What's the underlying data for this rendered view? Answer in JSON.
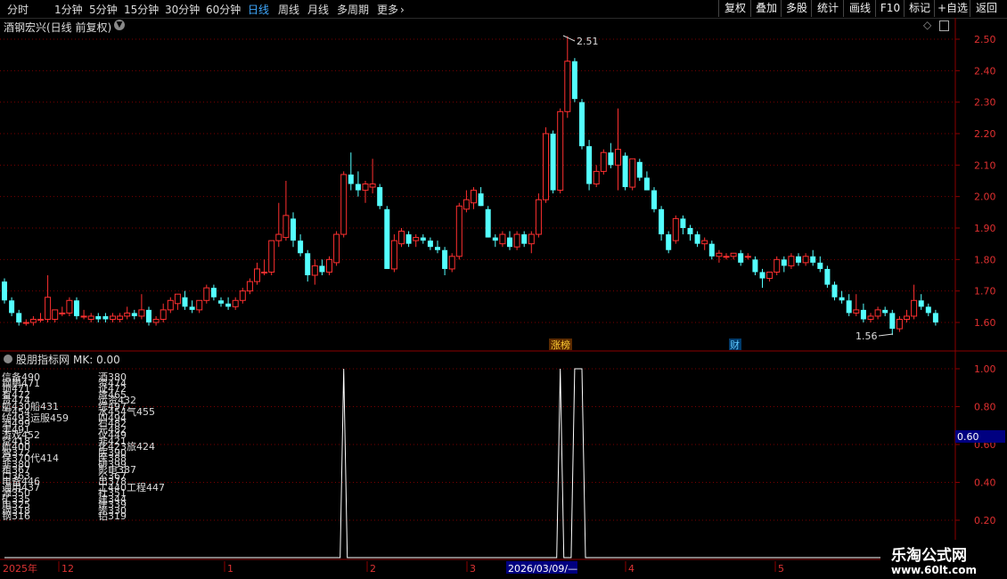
{
  "toolbar": {
    "periods": [
      "分时",
      "1分钟",
      "5分钟",
      "15分钟",
      "30分钟",
      "60分钟",
      "日线",
      "周线",
      "月线",
      "多周期",
      "更多"
    ],
    "active_period": "日线",
    "more_arrow": "›",
    "right_buttons": [
      "复权",
      "叠加",
      "多股",
      "统计",
      "画线",
      "F10",
      "标记",
      "+自选",
      "返回"
    ]
  },
  "header": {
    "stock_title": "酒钢宏兴(日线 前复权)",
    "chevron_icon": "chevron-down-icon",
    "diamond_icon": "diamond-icon",
    "panel_icon": "panel-toggle-icon"
  },
  "price_axis": {
    "labels": [
      "2.50",
      "2.40",
      "2.30",
      "2.20",
      "2.10",
      "2.00",
      "1.90",
      "1.80",
      "1.70",
      "1.60"
    ]
  },
  "annotations": {
    "high_label": "2.51",
    "low_label": "1.56",
    "event_zhangbang": "涨榜",
    "event_cai": "财"
  },
  "indicator": {
    "title": "股朋指标网",
    "mk_label": "MK: 0.00",
    "axis_labels": [
      "1.00",
      "0.80",
      "0.60",
      "0.40",
      "0.20"
    ],
    "highlight_value": "0.60",
    "col1": [
      "信备490",
      "钢鹏471",
      "锁471",
      "有472",
      "贵474",
      "航430船431",
      "汽454",
      "纺493运服459",
      "酒499",
      "丰491",
      "游戏452",
      "空418",
      "航400",
      "智372",
      "保370代414",
      "非380",
      "租367",
      "口363",
      "电备446",
      "通用437",
      "源350",
      "矿335",
      "电325",
      "钢318",
      "钢316"
    ],
    "col2": [
      "酒380",
      "资474",
      "证472",
      "旅465",
      "运资432",
      "综497",
      "水454气455",
      "四494",
      "石482",
      "元482",
      "仪449",
      "非421",
      "化423旅424",
      "医390",
      "医388",
      "研399",
      "影电387",
      "公367",
      "出378",
      "工440工程447",
      "社351",
      "建344",
      "建339",
      "光330",
      "铝319"
    ]
  },
  "date_axis": {
    "labels": [
      "2025年",
      "12",
      "1",
      "2",
      "3",
      "4",
      "5"
    ],
    "cursor_date": "2026/03/09/—"
  },
  "watermark": {
    "line1": "乐淘公式网",
    "line2": "www.60lt.com"
  },
  "chart_data": {
    "type": "candlestick",
    "ylim": [
      1.55,
      2.53
    ],
    "y_ticks": [
      1.6,
      1.7,
      1.8,
      1.9,
      2.0,
      2.1,
      2.2,
      2.3,
      2.4,
      2.5
    ],
    "max_price": 2.51,
    "min_price": 1.56,
    "candles": [
      {
        "o": 1.73,
        "h": 1.74,
        "l": 1.66,
        "c": 1.67
      },
      {
        "o": 1.67,
        "h": 1.68,
        "l": 1.62,
        "c": 1.63
      },
      {
        "o": 1.63,
        "h": 1.64,
        "l": 1.59,
        "c": 1.6
      },
      {
        "o": 1.6,
        "h": 1.61,
        "l": 1.59,
        "c": 1.6
      },
      {
        "o": 1.6,
        "h": 1.62,
        "l": 1.59,
        "c": 1.61
      },
      {
        "o": 1.61,
        "h": 1.63,
        "l": 1.6,
        "c": 1.61
      },
      {
        "o": 1.61,
        "h": 1.75,
        "l": 1.6,
        "c": 1.68
      },
      {
        "o": 1.61,
        "h": 1.64,
        "l": 1.6,
        "c": 1.64
      },
      {
        "o": 1.63,
        "h": 1.65,
        "l": 1.62,
        "c": 1.63
      },
      {
        "o": 1.63,
        "h": 1.68,
        "l": 1.62,
        "c": 1.67
      },
      {
        "o": 1.67,
        "h": 1.68,
        "l": 1.61,
        "c": 1.62
      },
      {
        "o": 1.62,
        "h": 1.64,
        "l": 1.61,
        "c": 1.62
      },
      {
        "o": 1.61,
        "h": 1.63,
        "l": 1.6,
        "c": 1.62
      },
      {
        "o": 1.62,
        "h": 1.63,
        "l": 1.6,
        "c": 1.61
      },
      {
        "o": 1.62,
        "h": 1.63,
        "l": 1.6,
        "c": 1.61
      },
      {
        "o": 1.61,
        "h": 1.63,
        "l": 1.6,
        "c": 1.62
      },
      {
        "o": 1.61,
        "h": 1.63,
        "l": 1.6,
        "c": 1.62
      },
      {
        "o": 1.62,
        "h": 1.65,
        "l": 1.61,
        "c": 1.63
      },
      {
        "o": 1.63,
        "h": 1.64,
        "l": 1.61,
        "c": 1.62
      },
      {
        "o": 1.62,
        "h": 1.69,
        "l": 1.61,
        "c": 1.64
      },
      {
        "o": 1.64,
        "h": 1.65,
        "l": 1.59,
        "c": 1.6
      },
      {
        "o": 1.6,
        "h": 1.62,
        "l": 1.59,
        "c": 1.61
      },
      {
        "o": 1.61,
        "h": 1.66,
        "l": 1.6,
        "c": 1.64
      },
      {
        "o": 1.64,
        "h": 1.68,
        "l": 1.63,
        "c": 1.67
      },
      {
        "o": 1.66,
        "h": 1.69,
        "l": 1.64,
        "c": 1.69
      },
      {
        "o": 1.68,
        "h": 1.7,
        "l": 1.64,
        "c": 1.65
      },
      {
        "o": 1.65,
        "h": 1.67,
        "l": 1.63,
        "c": 1.64
      },
      {
        "o": 1.64,
        "h": 1.67,
        "l": 1.63,
        "c": 1.67
      },
      {
        "o": 1.67,
        "h": 1.72,
        "l": 1.66,
        "c": 1.71
      },
      {
        "o": 1.71,
        "h": 1.72,
        "l": 1.67,
        "c": 1.68
      },
      {
        "o": 1.67,
        "h": 1.68,
        "l": 1.65,
        "c": 1.66
      },
      {
        "o": 1.66,
        "h": 1.68,
        "l": 1.64,
        "c": 1.65
      },
      {
        "o": 1.65,
        "h": 1.68,
        "l": 1.64,
        "c": 1.67
      },
      {
        "o": 1.67,
        "h": 1.71,
        "l": 1.66,
        "c": 1.7
      },
      {
        "o": 1.7,
        "h": 1.74,
        "l": 1.69,
        "c": 1.73
      },
      {
        "o": 1.73,
        "h": 1.79,
        "l": 1.72,
        "c": 1.77
      },
      {
        "o": 1.76,
        "h": 1.8,
        "l": 1.75,
        "c": 1.76
      },
      {
        "o": 1.76,
        "h": 1.86,
        "l": 1.75,
        "c": 1.86
      },
      {
        "o": 1.86,
        "h": 1.98,
        "l": 1.84,
        "c": 1.88
      },
      {
        "o": 1.87,
        "h": 2.05,
        "l": 1.86,
        "c": 1.94
      },
      {
        "o": 1.93,
        "h": 1.95,
        "l": 1.84,
        "c": 1.86
      },
      {
        "o": 1.86,
        "h": 1.88,
        "l": 1.81,
        "c": 1.82
      },
      {
        "o": 1.82,
        "h": 1.83,
        "l": 1.73,
        "c": 1.75
      },
      {
        "o": 1.75,
        "h": 1.8,
        "l": 1.72,
        "c": 1.78
      },
      {
        "o": 1.78,
        "h": 1.8,
        "l": 1.75,
        "c": 1.76
      },
      {
        "o": 1.76,
        "h": 1.81,
        "l": 1.75,
        "c": 1.8
      },
      {
        "o": 1.79,
        "h": 1.89,
        "l": 1.78,
        "c": 1.88
      },
      {
        "o": 1.88,
        "h": 2.08,
        "l": 1.87,
        "c": 2.07
      },
      {
        "o": 2.07,
        "h": 2.14,
        "l": 2.02,
        "c": 2.04
      },
      {
        "o": 2.04,
        "h": 2.08,
        "l": 2.0,
        "c": 2.02
      },
      {
        "o": 2.02,
        "h": 2.05,
        "l": 1.98,
        "c": 2.04
      },
      {
        "o": 2.03,
        "h": 2.12,
        "l": 2.01,
        "c": 2.04
      },
      {
        "o": 2.03,
        "h": 2.04,
        "l": 1.96,
        "c": 1.97
      },
      {
        "o": 1.96,
        "h": 1.97,
        "l": 1.77,
        "c": 1.77
      },
      {
        "o": 1.77,
        "h": 1.88,
        "l": 1.76,
        "c": 1.86
      },
      {
        "o": 1.85,
        "h": 1.9,
        "l": 1.84,
        "c": 1.89
      },
      {
        "o": 1.88,
        "h": 1.89,
        "l": 1.84,
        "c": 1.85
      },
      {
        "o": 1.86,
        "h": 1.88,
        "l": 1.84,
        "c": 1.87
      },
      {
        "o": 1.87,
        "h": 1.88,
        "l": 1.85,
        "c": 1.86
      },
      {
        "o": 1.86,
        "h": 1.87,
        "l": 1.83,
        "c": 1.84
      },
      {
        "o": 1.84,
        "h": 1.86,
        "l": 1.82,
        "c": 1.83
      },
      {
        "o": 1.83,
        "h": 1.84,
        "l": 1.75,
        "c": 1.77
      },
      {
        "o": 1.77,
        "h": 1.82,
        "l": 1.76,
        "c": 1.81
      },
      {
        "o": 1.81,
        "h": 1.98,
        "l": 1.8,
        "c": 1.97
      },
      {
        "o": 1.96,
        "h": 2.02,
        "l": 1.95,
        "c": 1.99
      },
      {
        "o": 1.98,
        "h": 2.03,
        "l": 1.96,
        "c": 2.02
      },
      {
        "o": 2.01,
        "h": 2.03,
        "l": 1.97,
        "c": 1.97
      },
      {
        "o": 1.96,
        "h": 1.97,
        "l": 1.87,
        "c": 1.87
      },
      {
        "o": 1.87,
        "h": 1.88,
        "l": 1.84,
        "c": 1.86
      },
      {
        "o": 1.85,
        "h": 1.89,
        "l": 1.84,
        "c": 1.88
      },
      {
        "o": 1.87,
        "h": 1.89,
        "l": 1.83,
        "c": 1.84
      },
      {
        "o": 1.84,
        "h": 1.89,
        "l": 1.83,
        "c": 1.88
      },
      {
        "o": 1.88,
        "h": 1.89,
        "l": 1.84,
        "c": 1.85
      },
      {
        "o": 1.85,
        "h": 1.89,
        "l": 1.82,
        "c": 1.88
      },
      {
        "o": 1.88,
        "h": 2.01,
        "l": 1.87,
        "c": 1.99
      },
      {
        "o": 1.99,
        "h": 2.22,
        "l": 1.98,
        "c": 2.2
      },
      {
        "o": 2.2,
        "h": 2.21,
        "l": 2.01,
        "c": 2.02
      },
      {
        "o": 2.02,
        "h": 2.28,
        "l": 2.01,
        "c": 2.27
      },
      {
        "o": 2.27,
        "h": 2.51,
        "l": 2.25,
        "c": 2.43
      },
      {
        "o": 2.43,
        "h": 2.44,
        "l": 2.3,
        "c": 2.31
      },
      {
        "o": 2.3,
        "h": 2.31,
        "l": 2.15,
        "c": 2.16
      },
      {
        "o": 2.16,
        "h": 2.18,
        "l": 2.02,
        "c": 2.04
      },
      {
        "o": 2.04,
        "h": 2.1,
        "l": 2.03,
        "c": 2.08
      },
      {
        "o": 2.08,
        "h": 2.15,
        "l": 2.07,
        "c": 2.14
      },
      {
        "o": 2.14,
        "h": 2.17,
        "l": 2.09,
        "c": 2.1
      },
      {
        "o": 2.1,
        "h": 2.28,
        "l": 2.02,
        "c": 2.15
      },
      {
        "o": 2.13,
        "h": 2.14,
        "l": 2.02,
        "c": 2.03
      },
      {
        "o": 2.03,
        "h": 2.12,
        "l": 2.02,
        "c": 2.12
      },
      {
        "o": 2.11,
        "h": 2.12,
        "l": 2.05,
        "c": 2.06
      },
      {
        "o": 2.06,
        "h": 2.08,
        "l": 2.02,
        "c": 2.02
      },
      {
        "o": 2.02,
        "h": 2.03,
        "l": 1.95,
        "c": 1.96
      },
      {
        "o": 1.96,
        "h": 1.97,
        "l": 1.86,
        "c": 1.88
      },
      {
        "o": 1.88,
        "h": 1.89,
        "l": 1.82,
        "c": 1.83
      },
      {
        "o": 1.86,
        "h": 1.94,
        "l": 1.85,
        "c": 1.93
      },
      {
        "o": 1.93,
        "h": 1.94,
        "l": 1.88,
        "c": 1.9
      },
      {
        "o": 1.9,
        "h": 1.91,
        "l": 1.86,
        "c": 1.88
      },
      {
        "o": 1.88,
        "h": 1.89,
        "l": 1.84,
        "c": 1.85
      },
      {
        "o": 1.85,
        "h": 1.87,
        "l": 1.83,
        "c": 1.86
      },
      {
        "o": 1.85,
        "h": 1.86,
        "l": 1.8,
        "c": 1.81
      },
      {
        "o": 1.81,
        "h": 1.83,
        "l": 1.79,
        "c": 1.82
      },
      {
        "o": 1.81,
        "h": 1.82,
        "l": 1.8,
        "c": 1.81
      },
      {
        "o": 1.81,
        "h": 1.82,
        "l": 1.8,
        "c": 1.82
      },
      {
        "o": 1.82,
        "h": 1.83,
        "l": 1.78,
        "c": 1.79
      },
      {
        "o": 1.81,
        "h": 1.82,
        "l": 1.8,
        "c": 1.81
      },
      {
        "o": 1.8,
        "h": 1.81,
        "l": 1.75,
        "c": 1.76
      },
      {
        "o": 1.76,
        "h": 1.77,
        "l": 1.71,
        "c": 1.74
      },
      {
        "o": 1.74,
        "h": 1.76,
        "l": 1.73,
        "c": 1.76
      },
      {
        "o": 1.76,
        "h": 1.81,
        "l": 1.75,
        "c": 1.8
      },
      {
        "o": 1.8,
        "h": 1.81,
        "l": 1.76,
        "c": 1.78
      },
      {
        "o": 1.78,
        "h": 1.82,
        "l": 1.77,
        "c": 1.81
      },
      {
        "o": 1.81,
        "h": 1.82,
        "l": 1.78,
        "c": 1.79
      },
      {
        "o": 1.79,
        "h": 1.82,
        "l": 1.78,
        "c": 1.81
      },
      {
        "o": 1.81,
        "h": 1.83,
        "l": 1.78,
        "c": 1.79
      },
      {
        "o": 1.79,
        "h": 1.81,
        "l": 1.76,
        "c": 1.77
      },
      {
        "o": 1.77,
        "h": 1.78,
        "l": 1.71,
        "c": 1.72
      },
      {
        "o": 1.72,
        "h": 1.73,
        "l": 1.67,
        "c": 1.68
      },
      {
        "o": 1.68,
        "h": 1.7,
        "l": 1.66,
        "c": 1.67
      },
      {
        "o": 1.67,
        "h": 1.69,
        "l": 1.62,
        "c": 1.63
      },
      {
        "o": 1.63,
        "h": 1.69,
        "l": 1.62,
        "c": 1.64
      },
      {
        "o": 1.64,
        "h": 1.66,
        "l": 1.6,
        "c": 1.61
      },
      {
        "o": 1.61,
        "h": 1.63,
        "l": 1.6,
        "c": 1.62
      },
      {
        "o": 1.62,
        "h": 1.65,
        "l": 1.61,
        "c": 1.64
      },
      {
        "o": 1.64,
        "h": 1.65,
        "l": 1.62,
        "c": 1.63
      },
      {
        "o": 1.63,
        "h": 1.64,
        "l": 1.56,
        "c": 1.58
      },
      {
        "o": 1.58,
        "h": 1.62,
        "l": 1.57,
        "c": 1.61
      },
      {
        "o": 1.61,
        "h": 1.64,
        "l": 1.6,
        "c": 1.62
      },
      {
        "o": 1.62,
        "h": 1.72,
        "l": 1.61,
        "c": 1.67
      },
      {
        "o": 1.67,
        "h": 1.69,
        "l": 1.64,
        "c": 1.65
      },
      {
        "o": 1.65,
        "h": 1.66,
        "l": 1.62,
        "c": 1.63
      },
      {
        "o": 1.63,
        "h": 1.64,
        "l": 1.59,
        "c": 1.6
      }
    ],
    "indicator_series": {
      "name": "MK",
      "ylim": [
        0,
        1.05
      ],
      "spikes": [
        {
          "index": 47,
          "value": 1.0
        },
        {
          "index": 77,
          "value": 1.0
        },
        {
          "index": 79,
          "value": 1.0
        },
        {
          "index": 80,
          "value": 1.0
        }
      ]
    },
    "colors": {
      "up": "#ff3030",
      "down": "#54ffff",
      "grid": "#7a0000",
      "axis": "#8b0000"
    }
  }
}
